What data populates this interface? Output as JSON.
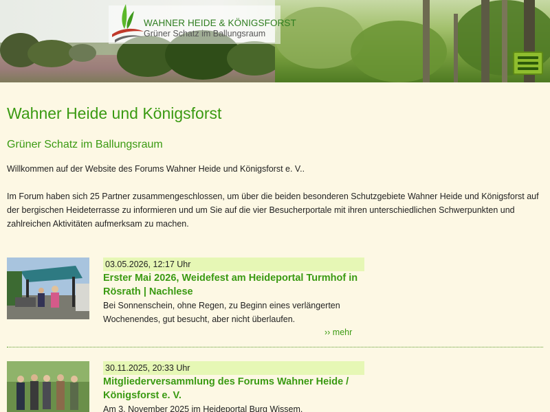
{
  "header": {
    "logo_title": "WAHNER HEIDE & KÖNIGSFORST",
    "logo_subtitle": "Grüner Schatz im Ballungsraum",
    "menu_icon": "hamburger-menu-icon"
  },
  "main": {
    "title": "Wahner Heide und Königsforst",
    "subtitle": "Grüner Schatz im Ballungsraum",
    "intro": [
      "Willkommen auf der Website des Forums Wahner Heide und Königsforst e. V..",
      "Im Forum haben sich 25 Partner zusammengeschlossen, um über die beiden besonderen Schutzgebiete Wahner Heide und Königsforst auf der bergischen Heideterrasse zu informieren und um Sie auf die vier Besucherportale mit ihren unterschiedlichen Schwerpunkten und zahlreichen Aktivitäten aufmerksam zu machen."
    ]
  },
  "news": [
    {
      "date": "03.05.2026, 12:17 Uhr",
      "title": "Erster Mai 2026, Weidefest am Heideportal Turmhof in Rösrath | Nachlese",
      "teaser": "Bei Sonnenschein, ohne Regen, zu Beginn eines verlängerten Wochenendes, gut besucht, aber nicht überlaufen.",
      "more": "›› mehr"
    },
    {
      "date": "30.11.2025, 20:33 Uhr",
      "title": "Mitgliederversammlung des Forums Wahner Heide / Königsforst e. V.",
      "teaser": "Am 3. November 2025 im Heideportal Burg Wissem."
    }
  ],
  "colors": {
    "background": "#fdf8e4",
    "heading_green": "#3a9a12",
    "date_bar": "#e6f7b5",
    "menu_button": "#8fbd2e"
  }
}
